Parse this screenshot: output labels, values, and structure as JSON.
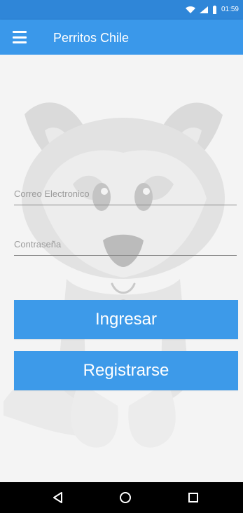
{
  "status_bar": {
    "time": "01:59",
    "icons": [
      "wifi-icon",
      "signal-icon",
      "battery-icon"
    ]
  },
  "app_bar": {
    "title": "Perritos Chile",
    "menu_icon": "menu-icon"
  },
  "form": {
    "email_placeholder": "Correo Electronico",
    "password_placeholder": "Contraseña",
    "email_value": "",
    "password_value": ""
  },
  "buttons": {
    "login_label": "Ingresar",
    "register_label": "Registrarse"
  },
  "navigation": {
    "icons": [
      "back-triangle-icon",
      "home-circle-icon",
      "recent-square-icon"
    ]
  },
  "colors": {
    "status_bar": "#2f86d8",
    "app_bar": "#3a98ea",
    "button": "#3d9ae9",
    "background": "#f4f4f4",
    "nav_bar": "#000000"
  }
}
